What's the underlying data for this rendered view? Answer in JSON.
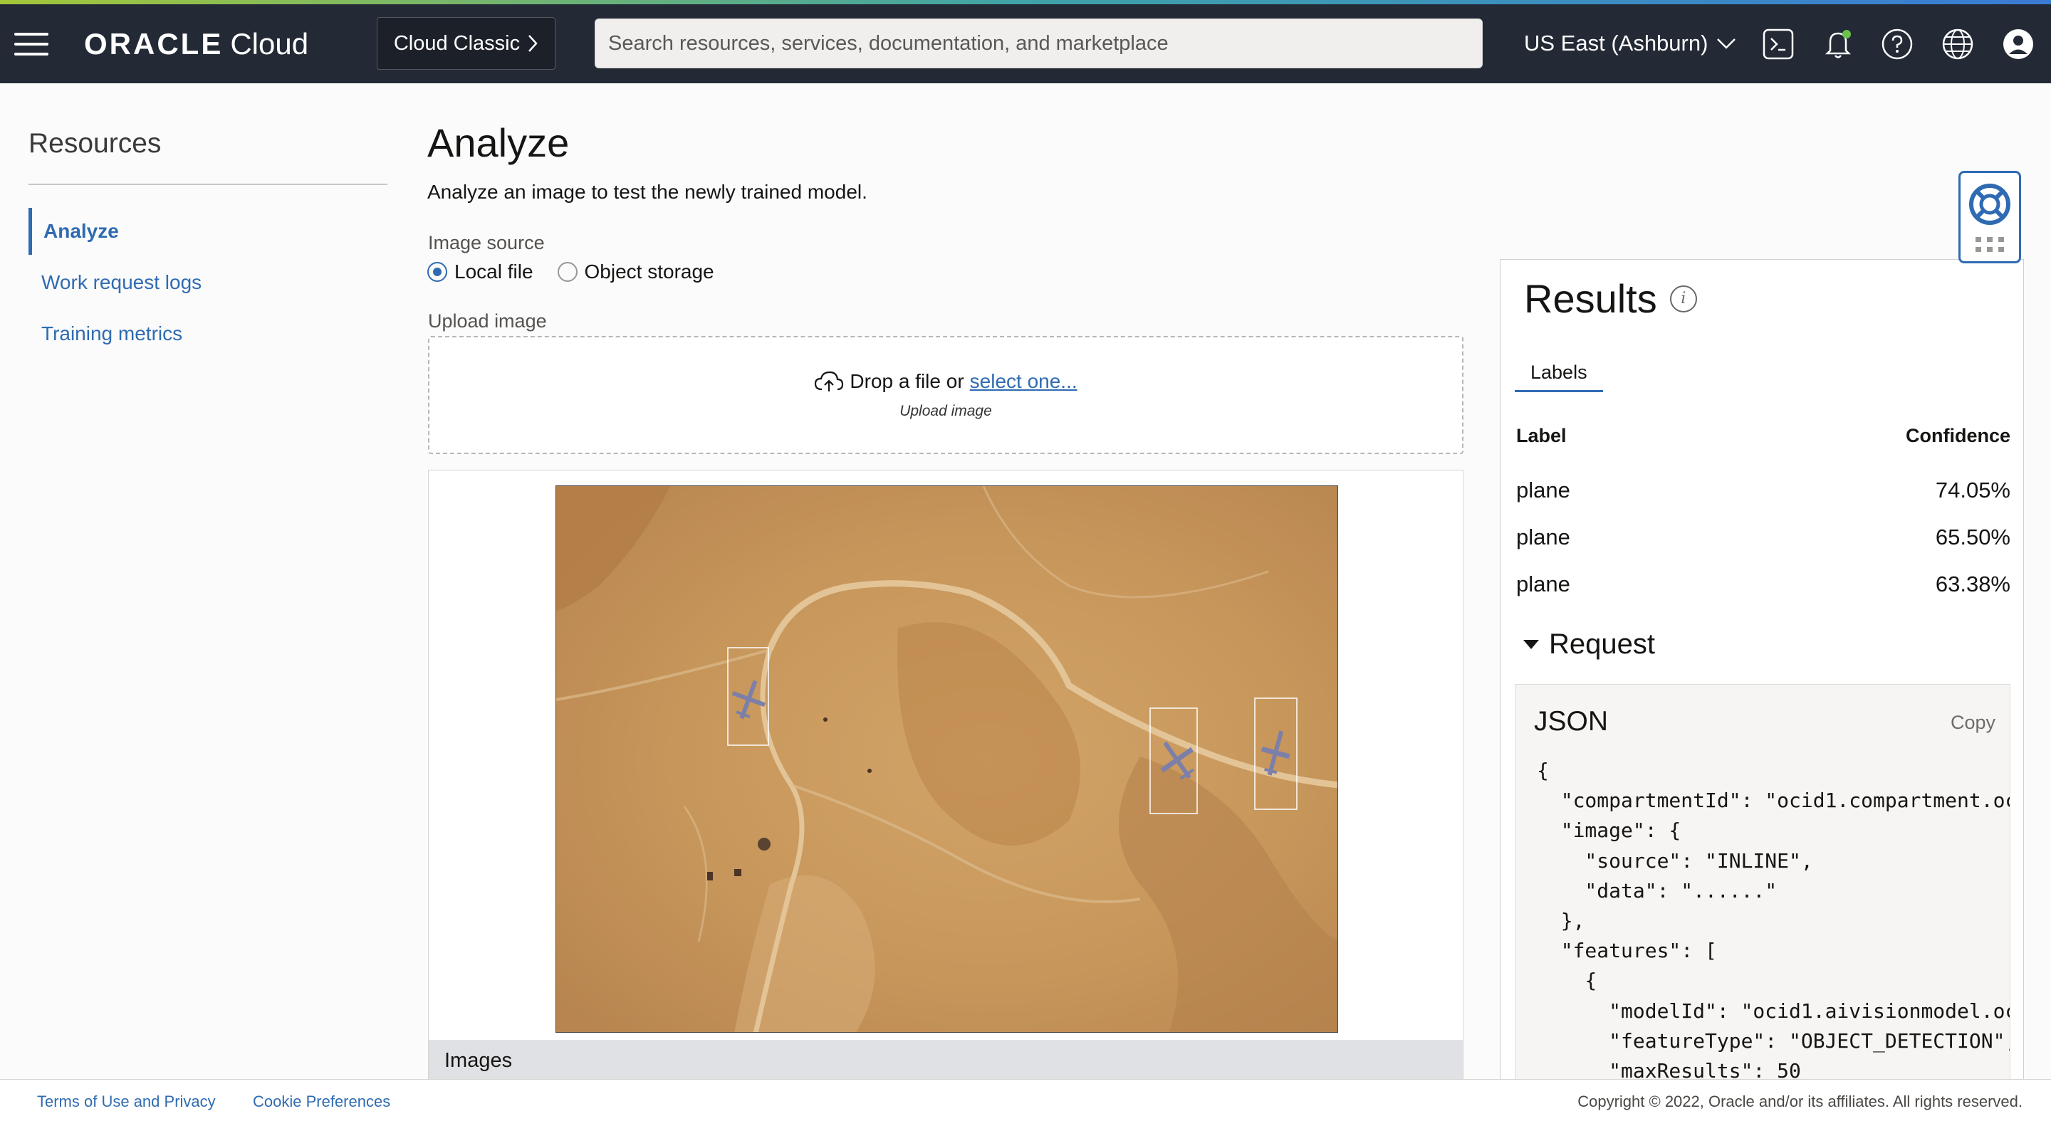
{
  "header": {
    "logo_oracle": "ORACLE",
    "logo_cloud": "Cloud",
    "classic_button": "Cloud Classic",
    "search_placeholder": "Search resources, services, documentation, and marketplace",
    "region": "US East (Ashburn)",
    "icons": [
      "cloud-shell-icon",
      "bell-icon",
      "help-icon",
      "globe-icon",
      "user-icon"
    ]
  },
  "sidebar": {
    "title": "Resources",
    "items": [
      {
        "label": "Analyze",
        "active": true
      },
      {
        "label": "Work request logs",
        "active": false
      },
      {
        "label": "Training metrics",
        "active": false
      }
    ]
  },
  "main": {
    "title": "Analyze",
    "description": "Analyze an image to test the newly trained model.",
    "image_source_label": "Image source",
    "radio_local": "Local file",
    "radio_object": "Object storage",
    "upload_label": "Upload image",
    "drop_text": "Drop a file or",
    "drop_link": "select one...",
    "drop_sub": "Upload image",
    "images_bar": "Images"
  },
  "results": {
    "title": "Results",
    "tab": "Labels",
    "col_label": "Label",
    "col_confidence": "Confidence",
    "rows": [
      {
        "label": "plane",
        "confidence": "74.05%"
      },
      {
        "label": "plane",
        "confidence": "65.50%"
      },
      {
        "label": "plane",
        "confidence": "63.38%"
      }
    ],
    "request_title": "Request",
    "json_title": "JSON",
    "copy": "Copy",
    "json_code": "{\n  \"compartmentId\": \"ocid1.compartment.oc\n  \"image\": {\n    \"source\": \"INLINE\",\n    \"data\": \"......\"\n  },\n  \"features\": [\n    {\n      \"modelId\": \"ocid1.aivisionmodel.oc\n      \"featureType\": \"OBJECT_DETECTION\",\n      \"maxResults\": 50"
  },
  "footer": {
    "terms": "Terms of Use and Privacy",
    "cookies": "Cookie Preferences",
    "copyright": "Copyright © 2022, Oracle and/or its affiliates. All rights reserved."
  },
  "colors": {
    "header_bg": "#232a36",
    "link": "#2f6bb2",
    "terrain": "#c8985a"
  }
}
